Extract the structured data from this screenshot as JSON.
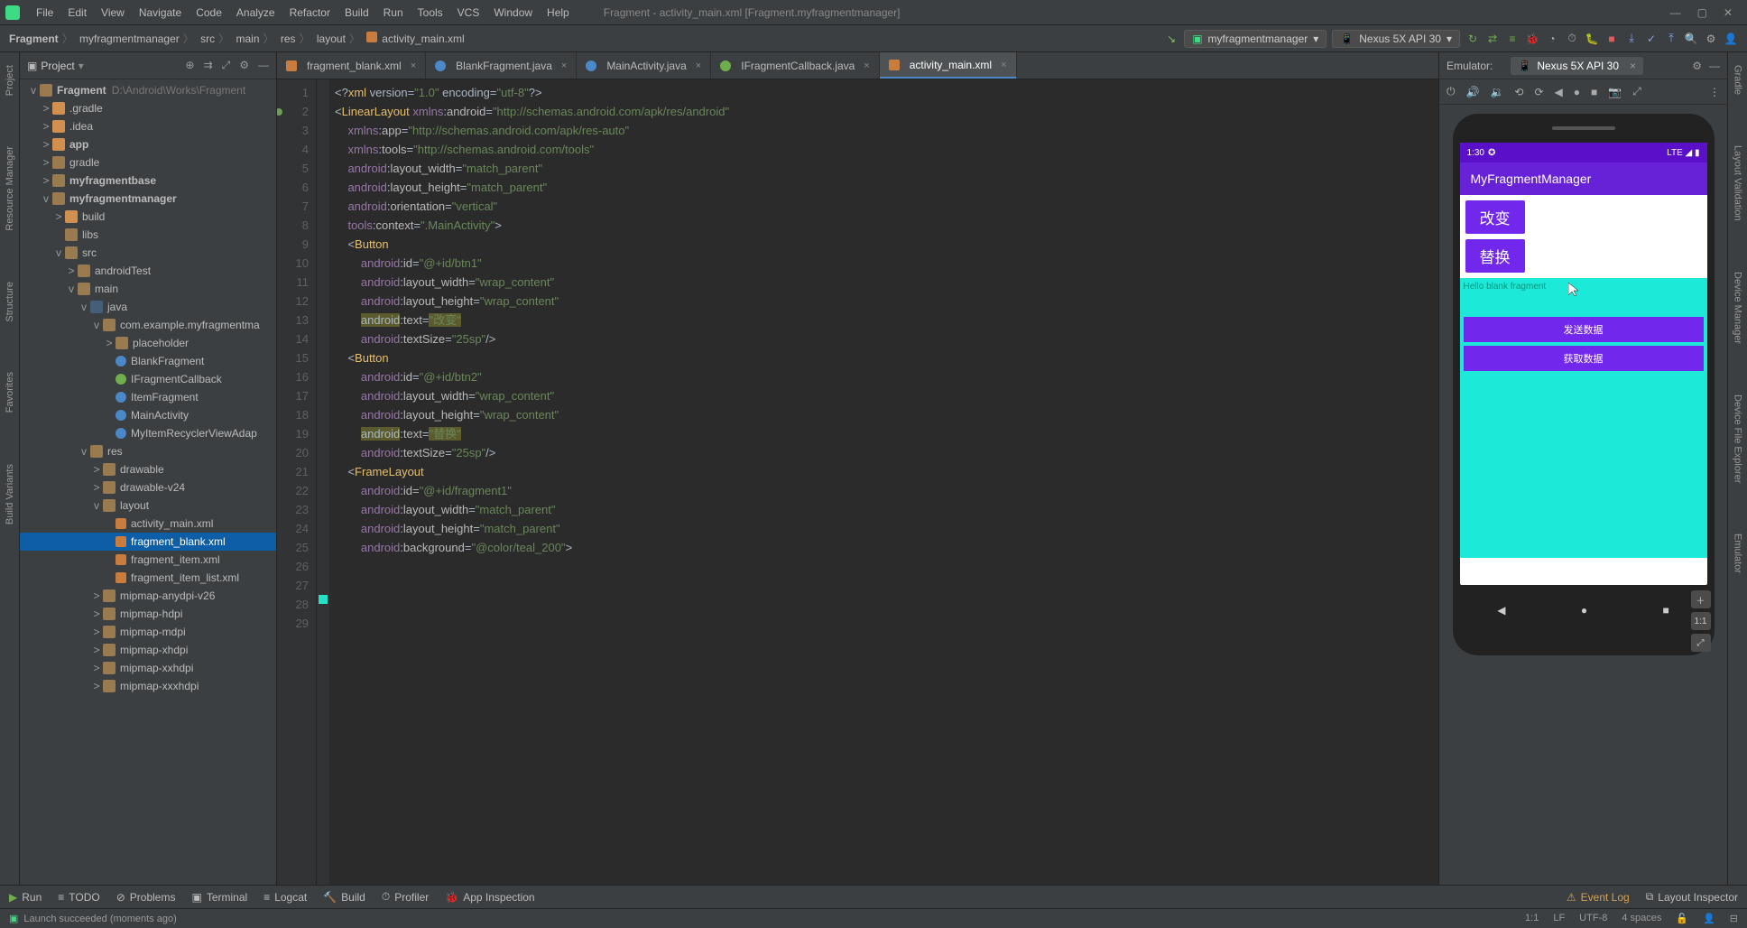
{
  "window_title": "Fragment - activity_main.xml [Fragment.myfragmentmanager]",
  "menu": [
    "File",
    "Edit",
    "View",
    "Navigate",
    "Code",
    "Analyze",
    "Refactor",
    "Build",
    "Run",
    "Tools",
    "VCS",
    "Window",
    "Help"
  ],
  "breadcrumb": [
    "Fragment",
    "myfragmentmanager",
    "src",
    "main",
    "res",
    "layout",
    "activity_main.xml"
  ],
  "run_config": "myfragmentmanager",
  "device_config": "Nexus 5X API 30",
  "left_vtabs": [
    "Project",
    "Resource Manager",
    "Structure",
    "Favorites",
    "Build Variants"
  ],
  "right_vtabs": [
    "Gradle",
    "Layout Validation",
    "Device Manager",
    "Device File Explorer",
    "Emulator"
  ],
  "project_panel": {
    "title": "Project",
    "root": "Fragment",
    "root_path": "D:\\Android\\Works\\Fragment",
    "tree": [
      {
        "d": 1,
        "t": ".gradle",
        "k": "diro",
        "car": ">"
      },
      {
        "d": 1,
        "t": ".idea",
        "k": "diro",
        "car": ">"
      },
      {
        "d": 1,
        "t": "app",
        "k": "diro",
        "car": ">",
        "bold": true
      },
      {
        "d": 1,
        "t": "gradle",
        "k": "dir",
        "car": ">"
      },
      {
        "d": 1,
        "t": "myfragmentbase",
        "k": "dir",
        "car": ">",
        "bold": true
      },
      {
        "d": 1,
        "t": "myfragmentmanager",
        "k": "dir",
        "car": "v",
        "bold": true
      },
      {
        "d": 2,
        "t": "build",
        "k": "diro",
        "car": ">"
      },
      {
        "d": 2,
        "t": "libs",
        "k": "dir",
        "car": ""
      },
      {
        "d": 2,
        "t": "src",
        "k": "dir",
        "car": "v"
      },
      {
        "d": 3,
        "t": "androidTest",
        "k": "dir",
        "car": ">"
      },
      {
        "d": 3,
        "t": "main",
        "k": "dir",
        "car": "v"
      },
      {
        "d": 4,
        "t": "java",
        "k": "src",
        "car": "v"
      },
      {
        "d": 5,
        "t": "com.example.myfragmentma",
        "k": "dir",
        "car": "v"
      },
      {
        "d": 6,
        "t": "placeholder",
        "k": "dir",
        "car": ">"
      },
      {
        "d": 6,
        "t": "BlankFragment",
        "k": "kt",
        "ic": "ci-kt"
      },
      {
        "d": 6,
        "t": "IFragmentCallback",
        "k": "kt",
        "ic": "ci-int"
      },
      {
        "d": 6,
        "t": "ItemFragment",
        "k": "kt",
        "ic": "ci-kt"
      },
      {
        "d": 6,
        "t": "MainActivity",
        "k": "kt",
        "ic": "ci-kt"
      },
      {
        "d": 6,
        "t": "MyItemRecyclerViewAdap",
        "k": "kt",
        "ic": "ci-kt"
      },
      {
        "d": 4,
        "t": "res",
        "k": "dir",
        "car": "v"
      },
      {
        "d": 5,
        "t": "drawable",
        "k": "dir",
        "car": ">"
      },
      {
        "d": 5,
        "t": "drawable-v24",
        "k": "dir",
        "car": ">"
      },
      {
        "d": 5,
        "t": "layout",
        "k": "dir",
        "car": "v"
      },
      {
        "d": 6,
        "t": "activity_main.xml",
        "k": "xml",
        "ic": "ci-xml"
      },
      {
        "d": 6,
        "t": "fragment_blank.xml",
        "k": "xml",
        "ic": "ci-xml",
        "sel": true
      },
      {
        "d": 6,
        "t": "fragment_item.xml",
        "k": "xml",
        "ic": "ci-xml"
      },
      {
        "d": 6,
        "t": "fragment_item_list.xml",
        "k": "xml",
        "ic": "ci-xml"
      },
      {
        "d": 5,
        "t": "mipmap-anydpi-v26",
        "k": "dir",
        "car": ">"
      },
      {
        "d": 5,
        "t": "mipmap-hdpi",
        "k": "dir",
        "car": ">"
      },
      {
        "d": 5,
        "t": "mipmap-mdpi",
        "k": "dir",
        "car": ">"
      },
      {
        "d": 5,
        "t": "mipmap-xhdpi",
        "k": "dir",
        "car": ">"
      },
      {
        "d": 5,
        "t": "mipmap-xxhdpi",
        "k": "dir",
        "car": ">"
      },
      {
        "d": 5,
        "t": "mipmap-xxxhdpi",
        "k": "dir",
        "car": ">"
      }
    ]
  },
  "tabs": [
    {
      "label": "fragment_blank.xml",
      "icon": "xml"
    },
    {
      "label": "BlankFragment.java",
      "icon": "kt"
    },
    {
      "label": "MainActivity.java",
      "icon": "kt"
    },
    {
      "label": "IFragmentCallback.java",
      "icon": "int"
    },
    {
      "label": "activity_main.xml",
      "icon": "xml",
      "active": true
    }
  ],
  "code_lines": [
    "<?xml version=\"1.0\" encoding=\"utf-8\"?>",
    "<LinearLayout xmlns:android=\"http://schemas.android.com/apk/res/android\"",
    "    xmlns:app=\"http://schemas.android.com/apk/res-auto\"",
    "    xmlns:tools=\"http://schemas.android.com/tools\"",
    "    android:layout_width=\"match_parent\"",
    "    android:layout_height=\"match_parent\"",
    "    android:orientation=\"vertical\"",
    "    tools:context=\".MainActivity\">",
    "",
    "    <Button",
    "        android:id=\"@+id/btn1\"",
    "        android:layout_width=\"wrap_content\"",
    "        android:layout_height=\"wrap_content\"",
    "        android:text=\"改变\"",
    "        android:textSize=\"25sp\"/>",
    "",
    "    <Button",
    "        android:id=\"@+id/btn2\"",
    "        android:layout_width=\"wrap_content\"",
    "        android:layout_height=\"wrap_content\"",
    "        android:text=\"替换\"",
    "        android:textSize=\"25sp\"/>",
    "",
    "    <FrameLayout",
    "        android:id=\"@+id/fragment1\"",
    "        android:layout_width=\"match_parent\"",
    "        android:layout_height=\"match_parent\"",
    "        android:background=\"@color/teal_200\">",
    ""
  ],
  "emulator": {
    "panel_title": "Emulator:",
    "tab": "Nexus 5X API 30",
    "status_time": "1:30",
    "status_right": "LTE ◢ ▮",
    "app_title": "MyFragmentManager",
    "btn1": "改变",
    "btn2": "替换",
    "frag_text": "Hello blank fragment",
    "send": "发送数据",
    "get": "获取数据"
  },
  "bottom": [
    {
      "icon": "▶",
      "label": "Run",
      "green": true
    },
    {
      "icon": "≡",
      "label": "TODO"
    },
    {
      "icon": "⊘",
      "label": "Problems"
    },
    {
      "icon": "▣",
      "label": "Terminal"
    },
    {
      "icon": "≡",
      "label": "Logcat"
    },
    {
      "icon": "🔨",
      "label": "Build"
    },
    {
      "icon": "⏱",
      "label": "Profiler"
    },
    {
      "icon": "🐞",
      "label": "App Inspection"
    }
  ],
  "bottom_right": [
    {
      "icon": "⚠",
      "label": "Event Log",
      "warn": true
    },
    {
      "icon": "⧉",
      "label": "Layout Inspector"
    }
  ],
  "status_msg": "Launch succeeded (moments ago)",
  "status_right": [
    "1:1",
    "LF",
    "UTF-8",
    "4 spaces"
  ]
}
